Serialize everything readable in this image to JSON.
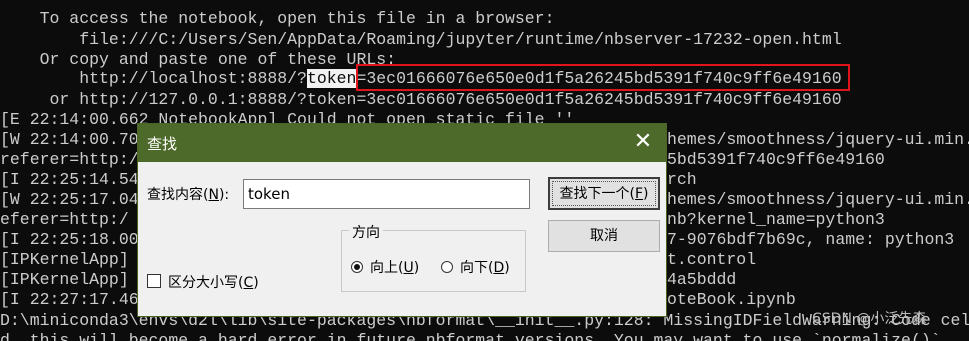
{
  "console": {
    "lines": [
      "    To access the notebook, open this file in a browser:",
      "        file:///C:/Users/Sen/AppData/Roaming/jupyter/runtime/nbserver-17232-open.html",
      "    Or copy and paste one of these URLs:",
      "        http://localhost:8888/?",
      "token",
      "=3ec01666076e650e0d1f5a26245bd5391f740c9ff6e49160",
      "     or http://127.0.0.1:8888/?token=3ec01666076e650e0d1f5a26245bd5391f740c9ff6e49160",
      "[E 22:14:00.662 NotebookApp] Could not open static file ''",
      "[W 22:14:00.70",
      "hemes/smoothness/jquery-ui.min.",
      "referer=http:/",
      "5bd5391f740c9ff6e49160",
      "[I 22:25:14.54",
      "rch",
      "[W 22:25:17.04",
      "hemes/smoothness/jquery-ui.min.",
      "eferer=http:/",
      "nb?kernel_name=python3",
      "[I 22:25:18.00",
      "7-9076bdf7b69c, name: python3",
      "[IPKernelApp]",
      "t.control",
      "[IPKernelApp]",
      "4a5bddd",
      "[I 22:27:17.46",
      "oteBook.ipynb",
      "D:\\miniconda3\\envs\\d2l\\lib\\site-packages\\nbformat\\__init__.py:128: MissingIDFieldWarning: Code cell",
      "d, this will become a hard error in future nbformat versions. You may want to use `normalize()`"
    ],
    "watermark": "CSDN @小泛先森"
  },
  "dialog": {
    "title": "查找",
    "close_glyph": "✕",
    "find_label": "查找内容(",
    "find_label_key": "N",
    "find_label_end": "):",
    "find_value": "token",
    "find_next_button": "查找下一个(",
    "find_next_key": "F",
    "find_next_end": ")",
    "cancel_button": "取消",
    "direction_group": "方向",
    "up_label": "向上(",
    "up_key": "U",
    "up_end": ")",
    "down_label": "向下(",
    "down_key": "D",
    "down_end": ")",
    "match_case_label": "区分大小写(",
    "match_case_key": "C",
    "match_case_end": ")",
    "direction_selected": "up",
    "match_case_checked": false,
    "accent_color": "#4e6a2a"
  }
}
